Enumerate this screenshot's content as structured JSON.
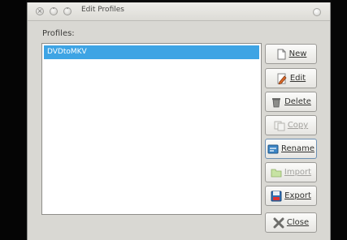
{
  "window": {
    "title": "Edit Profiles",
    "controls": [
      "close",
      "minimize",
      "maximize"
    ]
  },
  "profiles": {
    "label": "Profiles:",
    "items": [
      {
        "label": "DVDtoMKV",
        "selected": true
      }
    ]
  },
  "buttons": {
    "new": {
      "label": "New",
      "icon": "new-document-icon",
      "enabled": true
    },
    "edit": {
      "label": "Edit",
      "icon": "pencil-icon",
      "enabled": true
    },
    "delete": {
      "label": "Delete",
      "icon": "trash-icon",
      "enabled": true
    },
    "copy": {
      "label": "Copy",
      "icon": "copy-icon",
      "enabled": false
    },
    "rename": {
      "label": "Rename",
      "icon": "rename-icon",
      "enabled": true
    },
    "import": {
      "label": "Import",
      "icon": "folder-icon",
      "enabled": false
    },
    "export": {
      "label": "Export",
      "icon": "save-icon",
      "enabled": true
    },
    "close": {
      "label": "Close",
      "icon": "close-x-icon",
      "enabled": true
    }
  },
  "colors": {
    "selection": "#3ea4e4",
    "dialog_bg": "#d9d8d3"
  }
}
